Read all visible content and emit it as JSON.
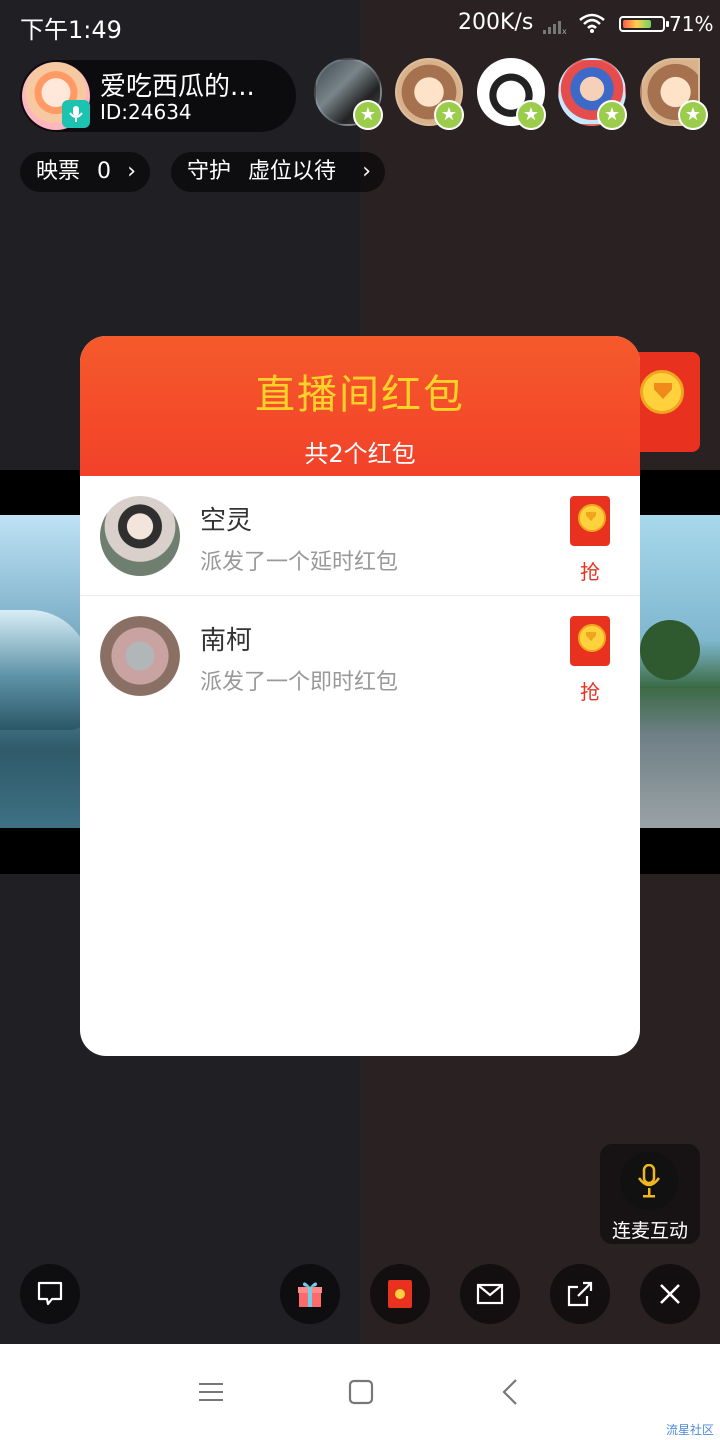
{
  "status_bar": {
    "time": "下午1:49",
    "speed": "200K/s",
    "battery": "71%"
  },
  "host": {
    "name": "爱吃西瓜的...",
    "id": "ID:24634"
  },
  "pills": {
    "votes_label": "映票",
    "votes_value": "0",
    "guard_label": "守护",
    "guard_value": "虚位以待"
  },
  "modal": {
    "title": "直播间红包",
    "subtitle": "共2个红包",
    "packets": [
      {
        "name": "空灵",
        "desc": "派发了一个延时红包",
        "grab": "抢"
      },
      {
        "name": "南柯",
        "desc": "派发了一个即时红包",
        "grab": "抢"
      }
    ]
  },
  "link_mic": {
    "label": "连麦互动"
  },
  "watermark": "流星社区",
  "colors": {
    "accent": "#f2412a",
    "gold": "#ffd22a",
    "badge": "#9ccc4c",
    "mic": "#1ec2b0"
  }
}
